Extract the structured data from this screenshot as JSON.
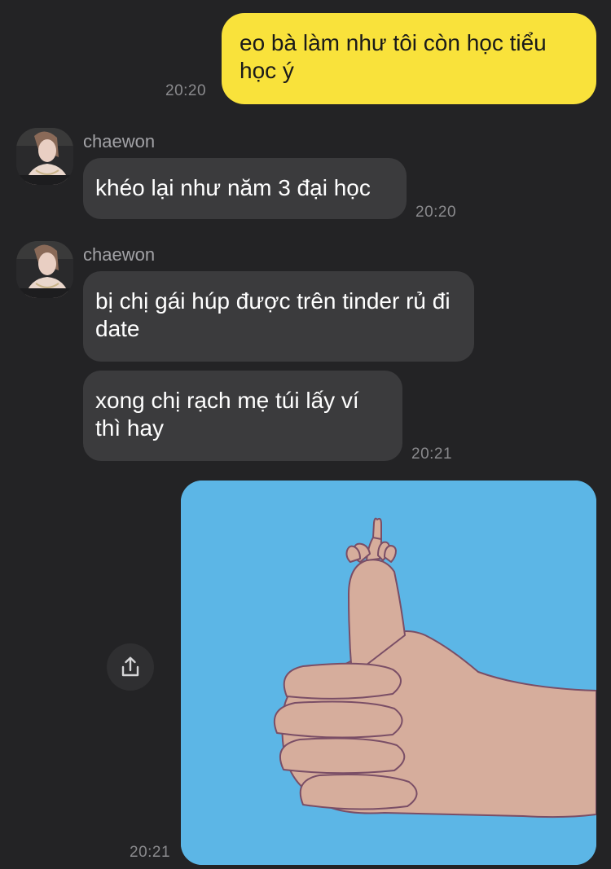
{
  "messages": {
    "m1": {
      "text": "eo bà làm như tôi còn học tiểu học ý",
      "time": "20:20"
    },
    "g1": {
      "sender": "chaewon",
      "text": "khéo lại như năm 3 đại học",
      "time": "20:20"
    },
    "g2": {
      "sender": "chaewon",
      "text1": "bị chị gái húp được trên tinder rủ đi date",
      "text2": "xong chị rạch mẹ túi lấy ví thì hay",
      "time": "20:21"
    },
    "image": {
      "time": "20:21",
      "icon": "share-icon"
    }
  },
  "colors": {
    "background": "#232325",
    "my_bubble": "#f9e23b",
    "their_bubble": "#3b3b3d",
    "image_sky": "#5bb5e4"
  }
}
